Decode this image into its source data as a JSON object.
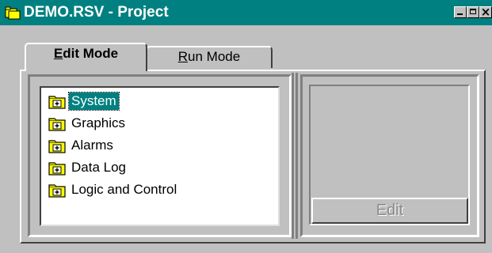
{
  "window": {
    "title": "DEMO.RSV - Project",
    "icon": "project-folder-icon",
    "controls": {
      "minimize": "minimize-icon",
      "maximize": "maximize-icon",
      "close": "×"
    }
  },
  "tabs": {
    "edit_mode": {
      "mnemonic": "E",
      "rest": "dit Mode",
      "active": true
    },
    "run_mode": {
      "mnemonic": "R",
      "rest": "un Mode",
      "active": false
    }
  },
  "tree": {
    "items": [
      {
        "label": "System",
        "icon": "folder-plus-icon",
        "selected": true
      },
      {
        "label": "Graphics",
        "icon": "folder-plus-icon",
        "selected": false
      },
      {
        "label": "Alarms",
        "icon": "folder-plus-icon",
        "selected": false
      },
      {
        "label": "Data Log",
        "icon": "folder-plus-icon",
        "selected": false
      },
      {
        "label": "Logic and Control",
        "icon": "folder-plus-icon",
        "selected": false
      }
    ]
  },
  "right_panel": {
    "edit_button": "Edit",
    "edit_enabled": false
  },
  "colors": {
    "titlebar": "#008080",
    "face": "#c0c0c0",
    "selection": "#008080",
    "folder": "#ffff00"
  }
}
